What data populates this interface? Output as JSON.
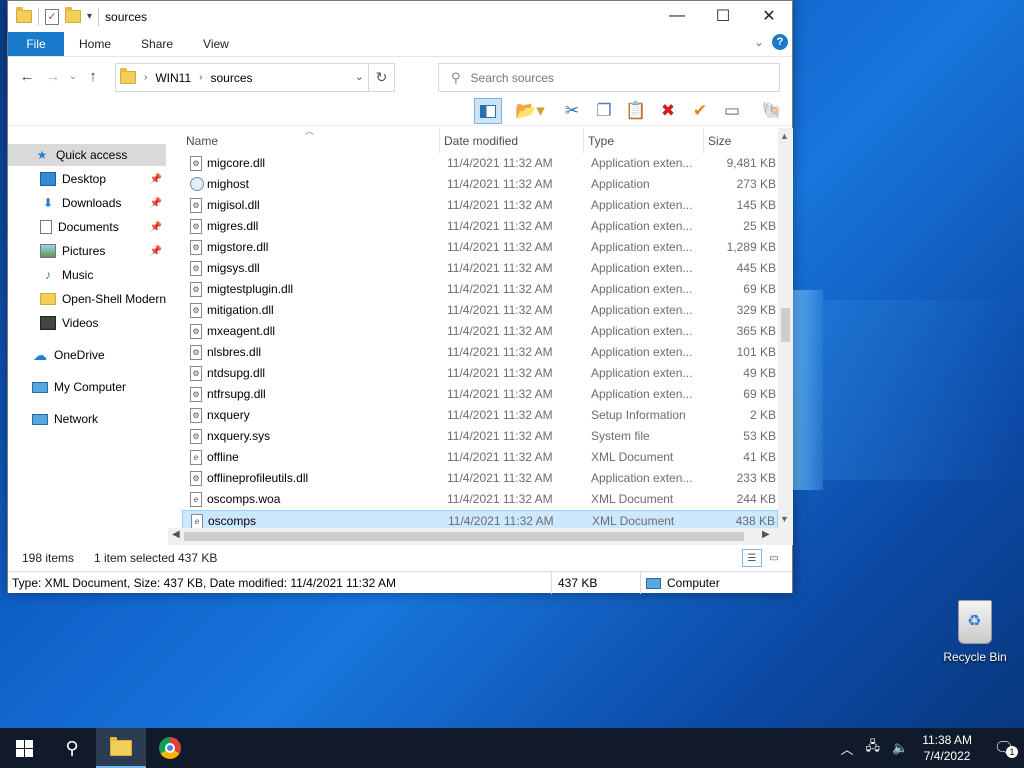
{
  "window": {
    "title": "sources",
    "controls": {
      "minimize": "—",
      "maximize": "☐",
      "close": "✕"
    }
  },
  "ribbon": {
    "tabs": [
      "File",
      "Home",
      "Share",
      "View"
    ],
    "help": "?"
  },
  "address": {
    "crumbs": [
      "WIN11",
      "sources"
    ],
    "search_placeholder": "Search sources"
  },
  "nav": {
    "items": [
      {
        "label": "Quick access",
        "icon": "star-icon",
        "selected": true
      },
      {
        "label": "Desktop",
        "icon": "desktop-icon",
        "pinned": true
      },
      {
        "label": "Downloads",
        "icon": "download-icon",
        "pinned": true
      },
      {
        "label": "Documents",
        "icon": "documents-icon",
        "pinned": true
      },
      {
        "label": "Pictures",
        "icon": "pictures-icon",
        "pinned": true
      },
      {
        "label": "Music",
        "icon": "music-icon"
      },
      {
        "label": "Open-Shell Modern",
        "icon": "folder-icon"
      },
      {
        "label": "Videos",
        "icon": "videos-icon"
      },
      {
        "label": "OneDrive",
        "icon": "cloud-icon"
      },
      {
        "label": "My Computer",
        "icon": "computer-icon"
      },
      {
        "label": "Network",
        "icon": "network-icon"
      }
    ]
  },
  "columns": {
    "name": "Name",
    "date": "Date modified",
    "type": "Type",
    "size": "Size"
  },
  "files": [
    {
      "name": "migcore.dll",
      "date": "11/4/2021 11:32 AM",
      "type": "Application exten...",
      "size": "9,481 KB",
      "icon": "dll"
    },
    {
      "name": "mighost",
      "date": "11/4/2021 11:32 AM",
      "type": "Application",
      "size": "273 KB",
      "icon": "app"
    },
    {
      "name": "migisol.dll",
      "date": "11/4/2021 11:32 AM",
      "type": "Application exten...",
      "size": "145 KB",
      "icon": "dll"
    },
    {
      "name": "migres.dll",
      "date": "11/4/2021 11:32 AM",
      "type": "Application exten...",
      "size": "25 KB",
      "icon": "dll"
    },
    {
      "name": "migstore.dll",
      "date": "11/4/2021 11:32 AM",
      "type": "Application exten...",
      "size": "1,289 KB",
      "icon": "dll"
    },
    {
      "name": "migsys.dll",
      "date": "11/4/2021 11:32 AM",
      "type": "Application exten...",
      "size": "445 KB",
      "icon": "dll"
    },
    {
      "name": "migtestplugin.dll",
      "date": "11/4/2021 11:32 AM",
      "type": "Application exten...",
      "size": "69 KB",
      "icon": "dll"
    },
    {
      "name": "mitigation.dll",
      "date": "11/4/2021 11:32 AM",
      "type": "Application exten...",
      "size": "329 KB",
      "icon": "dll"
    },
    {
      "name": "mxeagent.dll",
      "date": "11/4/2021 11:32 AM",
      "type": "Application exten...",
      "size": "365 KB",
      "icon": "dll"
    },
    {
      "name": "nlsbres.dll",
      "date": "11/4/2021 11:32 AM",
      "type": "Application exten...",
      "size": "101 KB",
      "icon": "dll"
    },
    {
      "name": "ntdsupg.dll",
      "date": "11/4/2021 11:32 AM",
      "type": "Application exten...",
      "size": "49 KB",
      "icon": "dll"
    },
    {
      "name": "ntfrsupg.dll",
      "date": "11/4/2021 11:32 AM",
      "type": "Application exten...",
      "size": "69 KB",
      "icon": "dll"
    },
    {
      "name": "nxquery",
      "date": "11/4/2021 11:32 AM",
      "type": "Setup Information",
      "size": "2 KB",
      "icon": "inf"
    },
    {
      "name": "nxquery.sys",
      "date": "11/4/2021 11:32 AM",
      "type": "System file",
      "size": "53 KB",
      "icon": "sys"
    },
    {
      "name": "offline",
      "date": "11/4/2021 11:32 AM",
      "type": "XML Document",
      "size": "41 KB",
      "icon": "xml"
    },
    {
      "name": "offlineprofileutils.dll",
      "date": "11/4/2021 11:32 AM",
      "type": "Application exten...",
      "size": "233 KB",
      "icon": "dll"
    },
    {
      "name": "oscomps.woa",
      "date": "11/4/2021 11:32 AM",
      "type": "XML Document",
      "size": "244 KB",
      "icon": "xml"
    },
    {
      "name": "oscomps",
      "date": "11/4/2021 11:32 AM",
      "type": "XML Document",
      "size": "438 KB",
      "icon": "xml",
      "selected": true
    }
  ],
  "status": {
    "count": "198 items",
    "selection": "1 item selected",
    "selection_size": "437 KB"
  },
  "details": {
    "text": "Type: XML Document, Size: 437 KB, Date modified: 11/4/2021 11:32 AM",
    "size": "437 KB",
    "location": "Computer"
  },
  "desktop": {
    "recycle_bin": "Recycle Bin"
  },
  "taskbar": {
    "time": "11:38 AM",
    "date": "7/4/2022",
    "notifications": "1"
  },
  "colors": {
    "accent": "#1979ca",
    "selection": "#cce8ff",
    "taskbar": "#101a2a"
  }
}
